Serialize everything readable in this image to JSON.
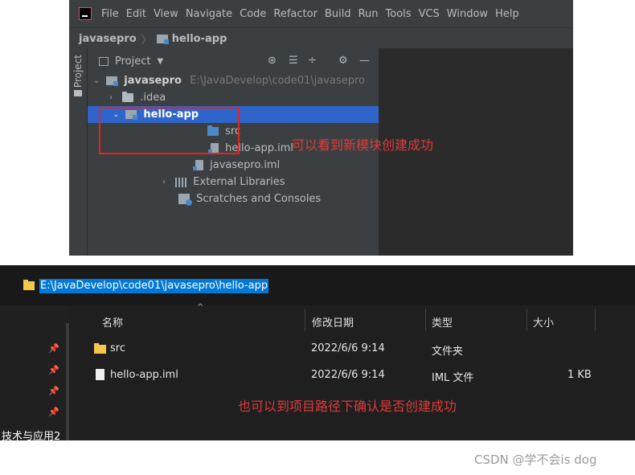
{
  "ide": {
    "menu": [
      "File",
      "Edit",
      "View",
      "Navigate",
      "Code",
      "Refactor",
      "Build",
      "Run",
      "Tools",
      "VCS",
      "Window",
      "Help"
    ],
    "breadcrumb": {
      "root": "javasepro",
      "separator": "〉",
      "module": "hello-app"
    },
    "side_tab": "Project",
    "panel_title": "Project",
    "tree": {
      "root": {
        "name": "javasepro",
        "path": "E:\\JavaDevelop\\code01\\javasepro"
      },
      "idea": ".idea",
      "module": "hello-app",
      "src": "src",
      "module_iml": "hello-app.iml",
      "project_iml": "javasepro.iml",
      "external_libraries": "External Libraries",
      "scratches": "Scratches and Consoles"
    },
    "annotation": "可以看到新模块创建成功"
  },
  "explorer": {
    "address": "E:\\JavaDevelop\\code01\\javasepro\\hello-app",
    "columns": {
      "name": "名称",
      "date": "修改日期",
      "type": "类型",
      "size": "大小"
    },
    "rows": [
      {
        "name": "src",
        "date": "2022/6/6 9:14",
        "type": "文件夹",
        "size": ""
      },
      {
        "name": "hello-app.iml",
        "date": "2022/6/6 9:14",
        "type": "IML 文件",
        "size": "1 KB"
      }
    ],
    "nav_label": "技术与应用2",
    "annotation": "也可以到项目路径下确认是否创建成功"
  },
  "watermark": "CSDN @学不会is dog"
}
